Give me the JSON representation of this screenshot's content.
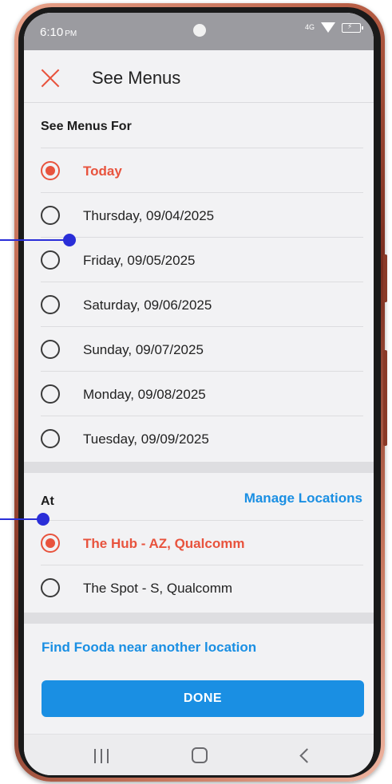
{
  "status_bar": {
    "time": "6:10",
    "time_suffix": "PM",
    "network": "4G"
  },
  "header": {
    "title": "See Menus"
  },
  "dates": {
    "section_title": "See Menus For",
    "options": [
      {
        "label": "Today",
        "selected": true
      },
      {
        "label": "Thursday, 09/04/2025",
        "selected": false
      },
      {
        "label": "Friday, 09/05/2025",
        "selected": false
      },
      {
        "label": "Saturday, 09/06/2025",
        "selected": false
      },
      {
        "label": "Sunday, 09/07/2025",
        "selected": false
      },
      {
        "label": "Monday, 09/08/2025",
        "selected": false
      },
      {
        "label": "Tuesday, 09/09/2025",
        "selected": false
      }
    ]
  },
  "locations": {
    "section_title": "At",
    "manage_label": "Manage Locations",
    "options": [
      {
        "label": "The Hub - AZ, Qualcomm",
        "selected": true
      },
      {
        "label": "The Spot - S, Qualcomm",
        "selected": false
      }
    ]
  },
  "find_link": "Find Fooda near another location",
  "done_label": "DONE",
  "colors": {
    "accent_red": "#e8533d",
    "link_blue": "#1a8fe3",
    "annotation": "#2a2ed8"
  },
  "icons": [
    "close-icon",
    "radio-selected-icon",
    "radio-unselected-icon",
    "recent-apps-icon",
    "home-icon",
    "back-icon"
  ]
}
